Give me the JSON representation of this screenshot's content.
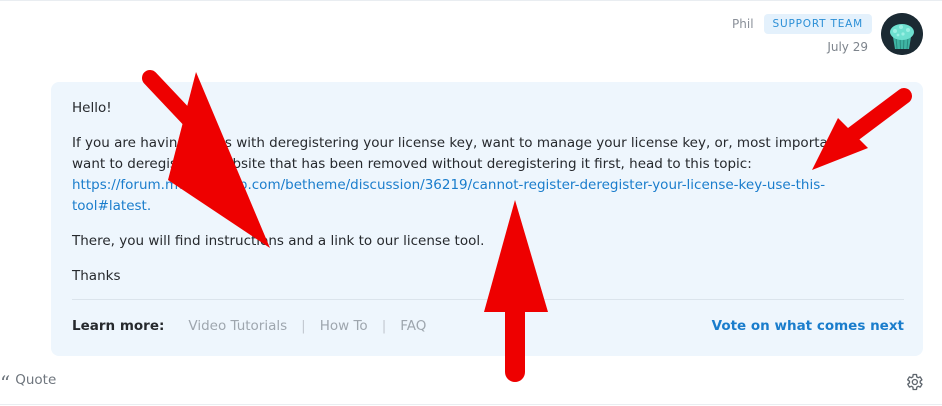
{
  "post": {
    "author": "Phil",
    "badge": "SUPPORT TEAM",
    "date": "July 29"
  },
  "message": {
    "greeting": "Hello!",
    "body_text": "If you are having issues with deregistering your license key, want to manage your license key, or, most importantly, want to deregister a website that has been removed without deregistering it first, head to this topic: ",
    "link": "https://forum.muffingroup.com/betheme/discussion/36219/cannot-register-deregister-your-license-key-use-this-tool#latest.",
    "instructions": "There, you will find instructions and a link to our license tool.",
    "sign_off": "Thanks"
  },
  "learn_more": {
    "label": "Learn more:",
    "links": [
      "Video Tutorials",
      "How To",
      "FAQ"
    ],
    "vote": "Vote on what comes next"
  },
  "actions": {
    "quote": "Quote"
  },
  "icons": {
    "quote": "quote-icon",
    "settings": "gear-icon",
    "avatar": "cupcake-avatar"
  },
  "colors": {
    "accent": "#1a7dcc",
    "bubble": "#eef6fd",
    "annotation_arrow": "#ee0000"
  }
}
